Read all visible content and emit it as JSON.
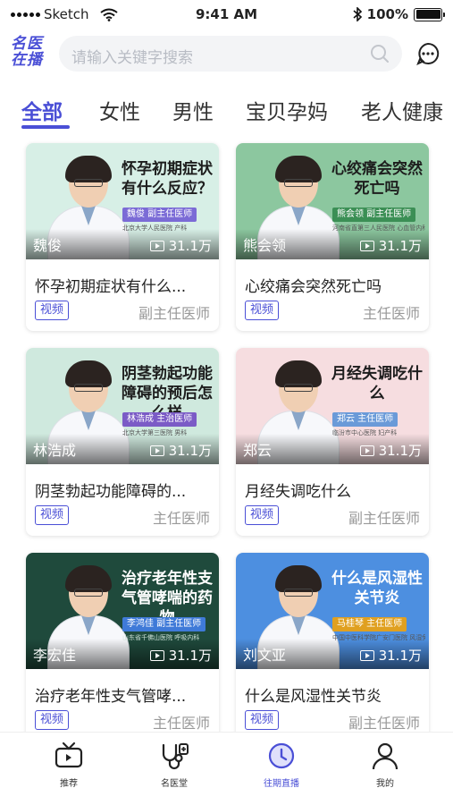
{
  "status_bar": {
    "carrier": "Sketch",
    "time": "9:41 AM",
    "battery": "100%"
  },
  "header": {
    "logo_line1": "名医",
    "logo_line2": "在播",
    "search_placeholder": "请输入关键字搜索"
  },
  "tabs": [
    {
      "label": "全部",
      "active": true
    },
    {
      "label": "女性",
      "active": false
    },
    {
      "label": "男性",
      "active": false
    },
    {
      "label": "宝贝孕妈",
      "active": false
    },
    {
      "label": "老人健康",
      "active": false
    }
  ],
  "cards": [
    {
      "headline": "怀孕初期症状有什么反应？",
      "tag": "魏俊  副主任医师",
      "hospital": "北京大学人民医院  产科",
      "doctor": "魏俊",
      "views": "31.1万",
      "title": "怀孕初期症状有什么...",
      "badge": "视频",
      "rank": "副主任医师",
      "bg": "#d7efe6",
      "tag_color": "#7b6bd6"
    },
    {
      "headline": "心绞痛会突然死亡吗",
      "tag": "熊会领  副主任医师",
      "hospital": "河南省直第三人民医院  心血管内科",
      "doctor": "熊会领",
      "views": "31.1万",
      "title": "心绞痛会突然死亡吗",
      "badge": "视频",
      "rank": "主任医师",
      "bg": "#8cc79f",
      "tag_color": "#3b8f55"
    },
    {
      "headline": "阴茎勃起功能障碍的预后怎么样",
      "tag": "林浩成  主治医师",
      "hospital": "北京大学第三医院  男科",
      "doctor": "林浩成",
      "views": "31.1万",
      "title": "阴茎勃起功能障碍的...",
      "badge": "视频",
      "rank": "主任医师",
      "bg": "#cfe9de",
      "tag_color": "#7b5bc6"
    },
    {
      "headline": "月经失调吃什么",
      "tag": "郑云  主任医师",
      "hospital": "临汾市中心医院  妇产科",
      "doctor": "郑云",
      "views": "31.1万",
      "title": "月经失调吃什么",
      "badge": "视频",
      "rank": "副主任医师",
      "bg": "#f6dde0",
      "tag_color": "#6a9ad8"
    },
    {
      "headline": "治疗老年性支气管哮喘的药物",
      "tag": "李鸿佳  副主任医师",
      "hospital": "山东省千佛山医院  呼吸内科",
      "doctor": "李宏佳",
      "views": "31.1万",
      "title": "治疗老年性支气管哮...",
      "badge": "视频",
      "rank": "主任医师",
      "bg": "#1f4a3c",
      "tag_color": "#3f7ad8"
    },
    {
      "headline": "什么是风湿性关节炎",
      "tag": "马桂琴  主任医师",
      "hospital": "中国中医科学院广安门医院  风湿免疫科",
      "doctor": "刘文亚",
      "views": "31.1万",
      "title": "什么是风湿性关节炎",
      "badge": "视频",
      "rank": "副主任医师",
      "bg": "#4d8fe0",
      "tag_color": "#e0a020"
    }
  ],
  "bottom_nav": [
    {
      "label": "推荐",
      "icon": "tv-icon",
      "active": false
    },
    {
      "label": "名医堂",
      "icon": "stethoscope-icon",
      "active": false
    },
    {
      "label": "往期直播",
      "icon": "clock-icon",
      "active": true
    },
    {
      "label": "我的",
      "icon": "user-icon",
      "active": false
    }
  ],
  "colors": {
    "accent": "#4a4fd6"
  }
}
